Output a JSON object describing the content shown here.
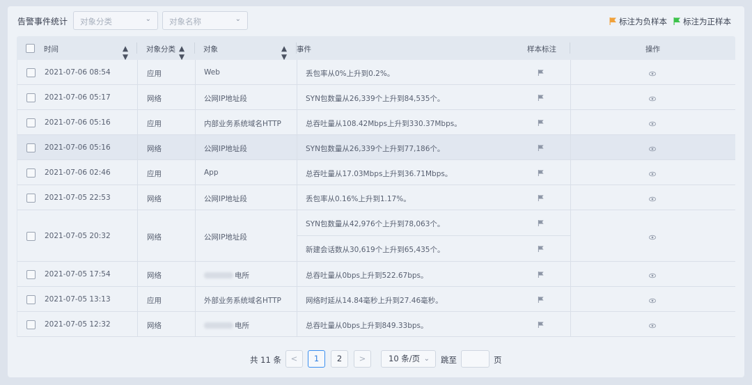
{
  "toolbar": {
    "title": "告警事件统计",
    "category_select_placeholder": "对象分类",
    "name_select_placeholder": "对象名称",
    "mark_negative_label": "标注为负样本",
    "mark_positive_label": "标注为正样本",
    "negative_color": "#f0a13a",
    "positive_color": "#3cc24a"
  },
  "table": {
    "headers": {
      "time": "时间",
      "category": "对象分类",
      "object": "对象",
      "event": "事件",
      "sample_mark": "样本标注",
      "action": "操作"
    },
    "rows": [
      {
        "time": "2021-07-06 08:54",
        "category": "应用",
        "object": "Web",
        "events": [
          "丢包率从0%上升到0.2%。"
        ]
      },
      {
        "time": "2021-07-06 05:17",
        "category": "网络",
        "object": "公网IP地址段",
        "events": [
          "SYN包数量从26,339个上升到84,535个。"
        ]
      },
      {
        "time": "2021-07-06 05:16",
        "category": "应用",
        "object": "内部业务系统域名HTTP",
        "events": [
          "总吞吐量从108.42Mbps上升到330.37Mbps。"
        ]
      },
      {
        "time": "2021-07-06 05:16",
        "category": "网络",
        "object": "公网IP地址段",
        "events": [
          "SYN包数量从26,339个上升到77,186个。"
        ]
      },
      {
        "time": "2021-07-06 02:46",
        "category": "应用",
        "object": "App",
        "events": [
          "总吞吐量从17.03Mbps上升到36.71Mbps。"
        ]
      },
      {
        "time": "2021-07-05 22:53",
        "category": "网络",
        "object": "公网IP地址段",
        "events": [
          "丢包率从0.16%上升到1.17%。"
        ]
      },
      {
        "time": "2021-07-05 20:32",
        "category": "网络",
        "object": "公网IP地址段",
        "events": [
          "SYN包数量从42,976个上升到78,063个。",
          "新建会话数从30,619个上升到65,435个。"
        ]
      },
      {
        "time": "2021-07-05 17:54",
        "category": "网络",
        "object": "电所",
        "events": [
          "总吞吐量从0bps上升到522.67bps。"
        ]
      },
      {
        "time": "2021-07-05 13:13",
        "category": "应用",
        "object": "外部业务系统域名HTTP",
        "events": [
          "网络时延从14.84毫秒上升到27.46毫秒。"
        ]
      },
      {
        "time": "2021-07-05 12:32",
        "category": "网络",
        "object": "电所",
        "events": [
          "总吞吐量从0bps上升到849.33bps。"
        ]
      }
    ]
  },
  "pagination": {
    "total": "共 11 条",
    "prev": "<",
    "page1": "1",
    "page2": "2",
    "next": ">",
    "page_size": "10 条/页",
    "jump_label": "跳至",
    "page_suffix": "页"
  }
}
